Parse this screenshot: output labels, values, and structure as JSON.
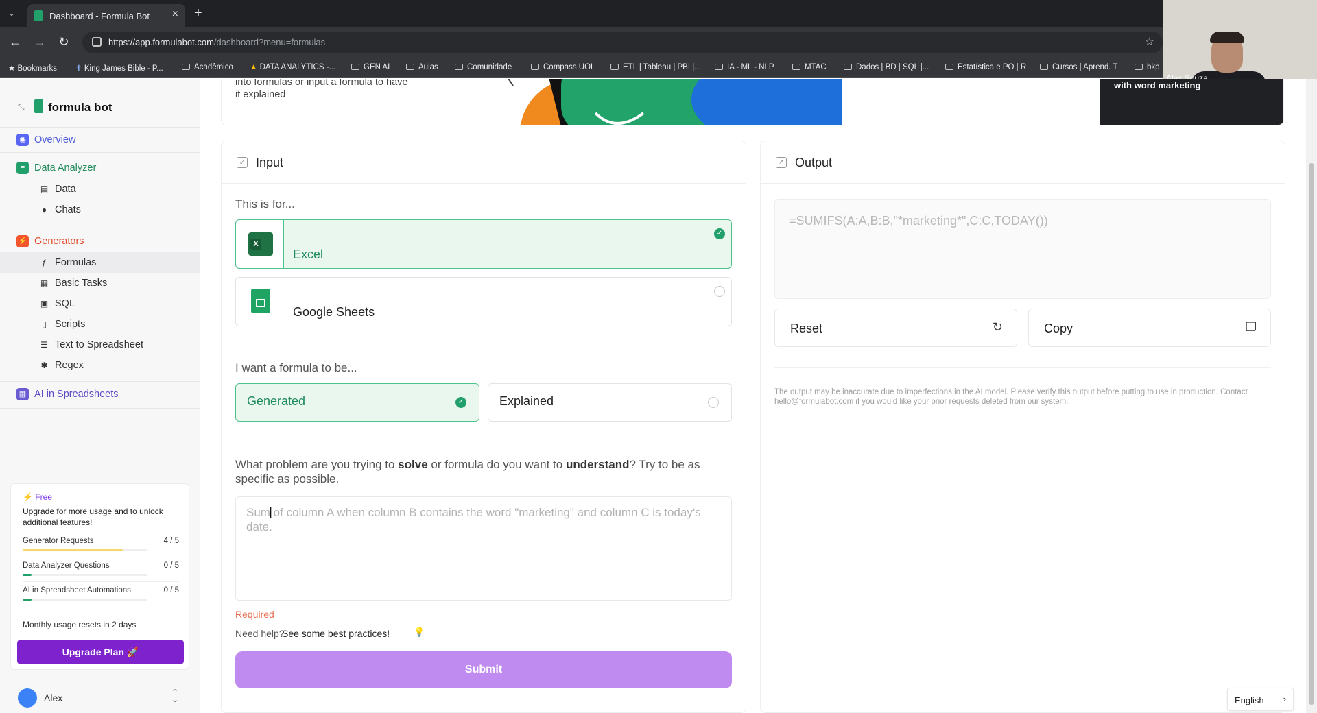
{
  "browser": {
    "tab_title": "Dashboard - Formula Bot",
    "url_host": "https://app.formulabot.com",
    "url_path": "/dashboard?menu=formulas",
    "bookmarks": [
      "Bookmarks",
      "King James Bible - P...",
      "Acadêmico",
      "DATA ANALYTICS -...",
      "GEN AI",
      "Aulas",
      "Comunidade",
      "Compass UOL",
      "ETL | Tableau | PBI |...",
      "IA - ML - NLP",
      "MTAC",
      "Dados | BD | SQL |...",
      "Estatística e PO | R",
      "Cursos | Aprend. T",
      "bkp"
    ],
    "webcam_name": "Alex Souza"
  },
  "sidebar": {
    "logo": "formula bot",
    "overview": "Overview",
    "data_analyzer": "Data Analyzer",
    "data": "Data",
    "chats": "Chats",
    "generators": "Generators",
    "formulas": "Formulas",
    "basic_tasks": "Basic Tasks",
    "sql": "SQL",
    "scripts": "Scripts",
    "text_to_spreadsheet": "Text to Spreadsheet",
    "regex": "Regex",
    "ai_spreadsheets": "AI in Spreadsheets",
    "colors": {
      "overview": "#5865f2",
      "data_analyzer": "#22a06b",
      "generators": "#f2542d",
      "ai_spreadsheets": "#6b5bd2"
    }
  },
  "usage": {
    "plan": "Free",
    "upgrade_text": "Upgrade for more usage and to unlock additional features!",
    "rows": [
      {
        "label": "Generator Requests",
        "count": "4 / 5",
        "fraction": 0.8,
        "color": "#f5d76e"
      },
      {
        "label": "Data Analyzer Questions",
        "count": "0 / 5",
        "fraction": 0.07,
        "color": "#22a06b"
      },
      {
        "label": "AI in Spreadsheet Automations",
        "count": "0 / 5",
        "fraction": 0.07,
        "color": "#22a06b"
      }
    ],
    "reset_note": "Monthly usage resets in 2 days",
    "upgrade_button": "Upgrade Plan"
  },
  "user": {
    "name": "Alex"
  },
  "banner": {
    "text": "into formulas or input a formula to have it explained",
    "dark_text": "with word marketing"
  },
  "input_panel": {
    "title": "Input",
    "for_label": "This is for...",
    "excel": "Excel",
    "sheets": "Google Sheets",
    "mode_label": "I want a formula to be...",
    "generated": "Generated",
    "explained": "Explained",
    "question_part1": "What problem are you trying to ",
    "question_bold1": "solve",
    "question_part2": " or formula do you want to ",
    "question_bold2": "understand",
    "question_part3": "? Try to be as specific as possible.",
    "textarea_placeholder": "Sum of column A when column B contains the word \"marketing\" and column C is today's date.",
    "required": "Required",
    "help_prefix": "Need help?",
    "help_link": "See some best practices!",
    "submit": "Submit"
  },
  "output_panel": {
    "title": "Output",
    "formula": "=SUMIFS(A:A,B:B,\"*marketing*\",C:C,TODAY())",
    "reset": "Reset",
    "copy": "Copy",
    "disclaimer": "The output may be inaccurate due to imperfections in the AI model. Please verify this output before putting to use in production. Contact hello@formulabot.com if you would like your prior requests deleted from our system."
  },
  "language": "English",
  "accent": {
    "green": "#22a06b",
    "purple": "#7e22ce",
    "submit": "#c08bf0"
  }
}
